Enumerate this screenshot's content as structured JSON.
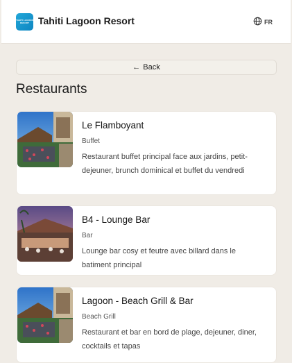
{
  "header": {
    "title": "Tahiti Lagoon Resort",
    "logo_text": "TAHITI LAGOON RESORT",
    "language": "FR"
  },
  "back_label": "Back",
  "section_title": "Restaurants",
  "restaurants": [
    {
      "name": "Le Flamboyant",
      "type": "Buffet",
      "description": "Restaurant buffet principal face aux jardins, petit-dejeuner, brunch dominical et buffet du vendredi"
    },
    {
      "name": "B4 - Lounge Bar",
      "type": "Bar",
      "description": "Lounge bar cosy et feutre avec billard dans le batiment principal"
    },
    {
      "name": "Lagoon - Beach Grill & Bar",
      "type": "Beach Grill",
      "description": "Restaurant et bar en bord de plage, dejeuner, diner, cocktails et tapas"
    }
  ],
  "colors": {
    "background": "#f0ece6",
    "brand": "#1a9fd4"
  }
}
